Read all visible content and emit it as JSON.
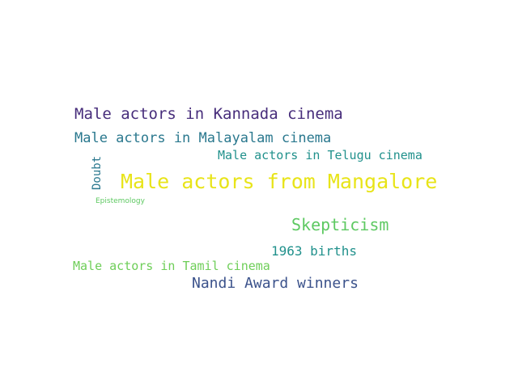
{
  "words": {
    "kannada": {
      "text": "Male actors in Kannada cinema",
      "color": "#472d7b"
    },
    "malayalam": {
      "text": "Male actors in Malayalam cinema",
      "color": "#2a788e"
    },
    "telugu": {
      "text": "Male actors in Telugu cinema",
      "color": "#21918c"
    },
    "doubt": {
      "text": "Doubt",
      "color": "#2a788e"
    },
    "mangalore": {
      "text": "Male actors from Mangalore",
      "color": "#e8e419"
    },
    "epistemology": {
      "text": "Epistemology",
      "color": "#5ec962"
    },
    "skepticism": {
      "text": "Skepticism",
      "color": "#5ec962"
    },
    "births": {
      "text": "1963 births",
      "color": "#21918c"
    },
    "tamil": {
      "text": "Male actors in Tamil cinema",
      "color": "#6ece58"
    },
    "nandi": {
      "text": "Nandi Award winners",
      "color": "#3b528b"
    }
  }
}
